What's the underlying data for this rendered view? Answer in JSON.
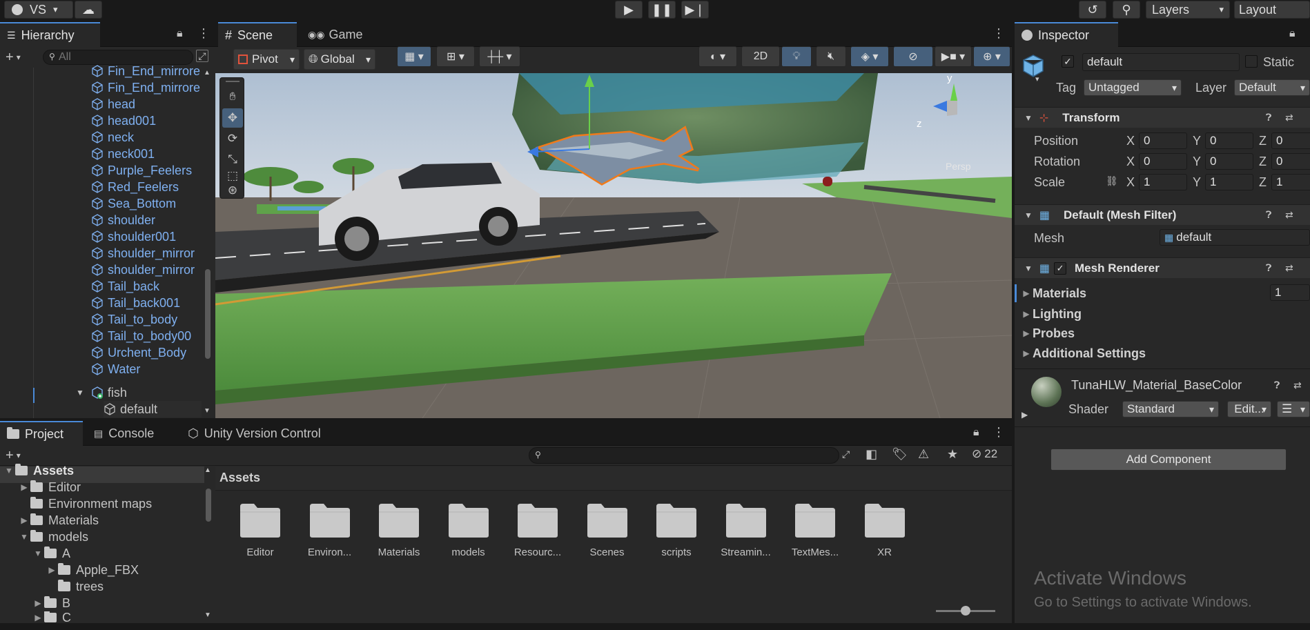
{
  "toolbar": {
    "account_label": "VS",
    "layers_label": "Layers",
    "layout_label": "Layout"
  },
  "hierarchy": {
    "tab_label": "Hierarchy",
    "search_placeholder": "All",
    "items": [
      {
        "label": "Fin_End_mirrore"
      },
      {
        "label": "Fin_End_mirrore"
      },
      {
        "label": "head"
      },
      {
        "label": "head001"
      },
      {
        "label": "neck"
      },
      {
        "label": "neck001"
      },
      {
        "label": "Purple_Feelers"
      },
      {
        "label": "Red_Feelers"
      },
      {
        "label": "Sea_Bottom"
      },
      {
        "label": "shoulder"
      },
      {
        "label": "shoulder001"
      },
      {
        "label": "shoulder_mirror"
      },
      {
        "label": "shoulder_mirror"
      },
      {
        "label": "Tail_back"
      },
      {
        "label": "Tail_back001"
      },
      {
        "label": "Tail_to_body"
      },
      {
        "label": "Tail_to_body00"
      },
      {
        "label": "Urchent_Body"
      },
      {
        "label": "Water"
      }
    ],
    "fish_label": "fish",
    "default_label": "default"
  },
  "scene": {
    "tab_scene": "Scene",
    "tab_game": "Game",
    "pivot_label": "Pivot",
    "global_label": "Global",
    "mode_2d": "2D",
    "persp_label": "Persp",
    "axis_y": "y",
    "axis_z": "z"
  },
  "inspector": {
    "tab_label": "Inspector",
    "object_name": "default",
    "static_label": "Static",
    "tag_label": "Tag",
    "tag_value": "Untagged",
    "layer_label": "Layer",
    "layer_value": "Default",
    "transform": {
      "title": "Transform",
      "position_label": "Position",
      "rotation_label": "Rotation",
      "scale_label": "Scale",
      "x": "X",
      "y": "Y",
      "z": "Z",
      "position": [
        "0",
        "0",
        "0"
      ],
      "rotation": [
        "0",
        "0",
        "0"
      ],
      "scale": [
        "1",
        "1",
        "1"
      ]
    },
    "mesh_filter": {
      "title": "Default (Mesh Filter)",
      "mesh_label": "Mesh",
      "mesh_value": "default"
    },
    "mesh_renderer": {
      "title": "Mesh Renderer",
      "materials_label": "Materials",
      "materials_count": "1",
      "lighting_label": "Lighting",
      "probes_label": "Probes",
      "additional_label": "Additional Settings"
    },
    "material": {
      "name": "TunaHLW_Material_BaseColor",
      "shader_label": "Shader",
      "shader_value": "Standard",
      "edit_label": "Edit..."
    },
    "add_component_label": "Add Component",
    "watermark_title": "Activate Windows",
    "watermark_sub": "Go to Settings to activate Windows."
  },
  "bottom": {
    "tab_project": "Project",
    "tab_console": "Console",
    "tab_uvc": "Unity Version Control",
    "hidden_count": "22",
    "tree": {
      "assets": "Assets",
      "editor": "Editor",
      "env_maps": "Environment maps",
      "materials": "Materials",
      "models": "models",
      "a": "A",
      "apple_fbx": "Apple_FBX",
      "trees": "trees",
      "b": "B",
      "c": "C"
    },
    "breadcrumb": "Assets",
    "folders": [
      "Editor",
      "Environ...",
      "Materials",
      "models",
      "Resourc...",
      "Scenes",
      "scripts",
      "Streamin...",
      "TextMes...",
      "XR"
    ]
  },
  "colors": {
    "accent": "#4a8ad8",
    "hierarchy_text": "#7fb0f0",
    "selection_outline": "#f07a1a"
  }
}
